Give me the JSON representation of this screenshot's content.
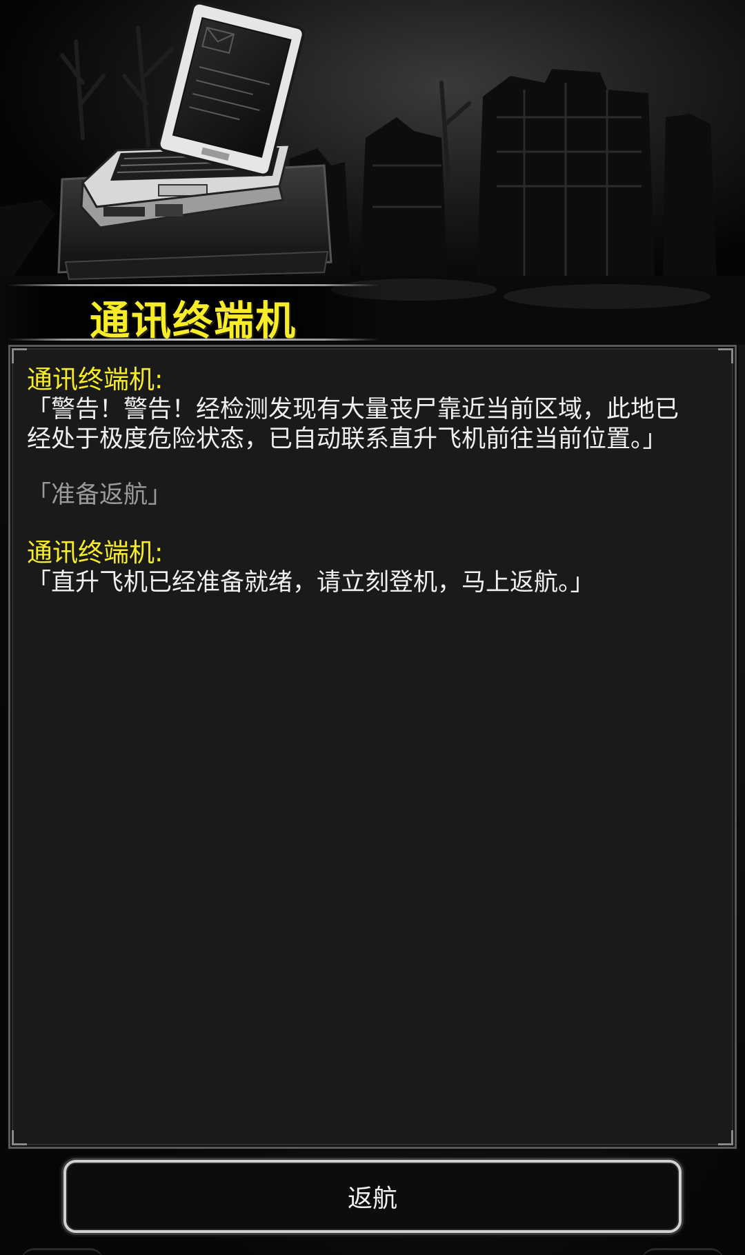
{
  "page": {
    "title": "通讯终端机"
  },
  "dialog": {
    "messages": [
      {
        "speaker": "通讯终端机:",
        "text": "「警告！警告！经检测发现有大量丧尸靠近当前区域，此地已\n经处于极度危险状态，已自动联系直升飞机前往当前位置。」"
      }
    ],
    "choice": "「准备返航」",
    "reply": {
      "speaker": "通讯终端机:",
      "text": "「直升飞机已经准备就绪，请立刻登机，马上返航。」"
    }
  },
  "actions": {
    "return_label": "返航"
  },
  "colors": {
    "speaker": "#f6ec2a",
    "message": "#f0f0f0",
    "choice": "#9a9a9a",
    "panel": "#1a1a1a"
  },
  "icons": {
    "header_art": "laptop-terminal-icon"
  }
}
